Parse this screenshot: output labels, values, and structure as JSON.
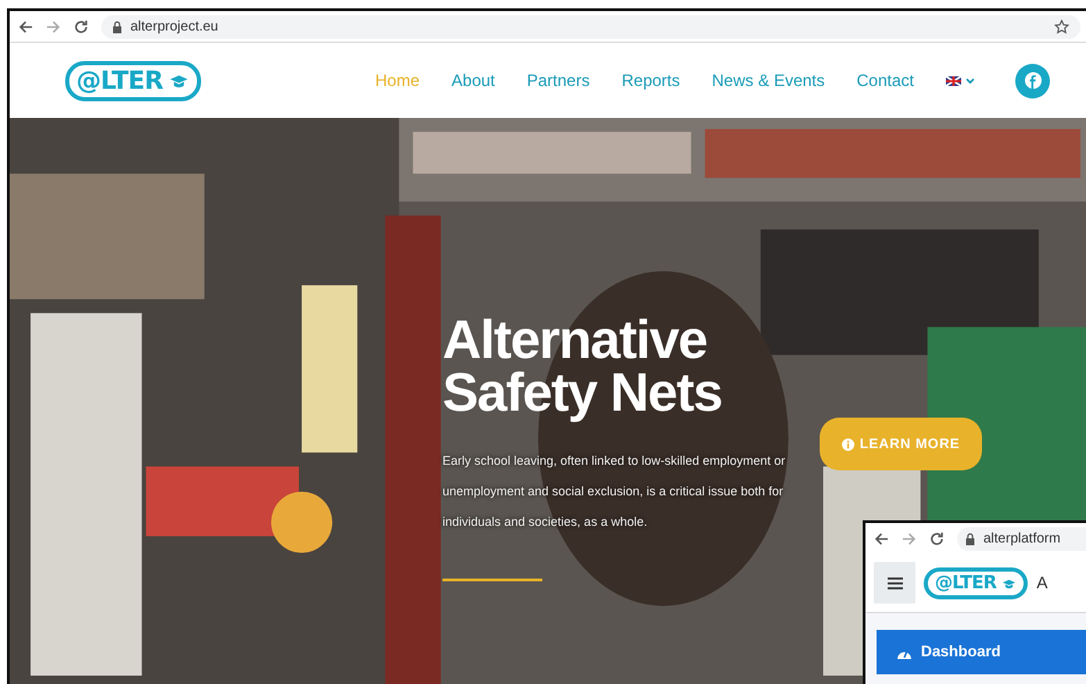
{
  "browser": {
    "url": "alterproject.eu"
  },
  "site": {
    "logo_text": "@LTER",
    "nav": [
      {
        "label": "Home",
        "selected": true
      },
      {
        "label": "About",
        "selected": false
      },
      {
        "label": "Partners",
        "selected": false
      },
      {
        "label": "Reports",
        "selected": false
      },
      {
        "label": "News & Events",
        "selected": false
      },
      {
        "label": "Contact",
        "selected": false
      }
    ]
  },
  "hero": {
    "title_lines": [
      "Alternative",
      "Safety Nets"
    ],
    "text": "Early school leaving, often linked to low-skilled employment or unemployment and social exclusion, is a critical issue both for individuals and societies, as a whole.",
    "button": "LEARN MORE"
  },
  "second_window": {
    "url": "alterplatform",
    "logo_text": "@LTER",
    "header_text": "A",
    "menu": [
      {
        "label": "Dashboard",
        "selected": true
      }
    ]
  }
}
